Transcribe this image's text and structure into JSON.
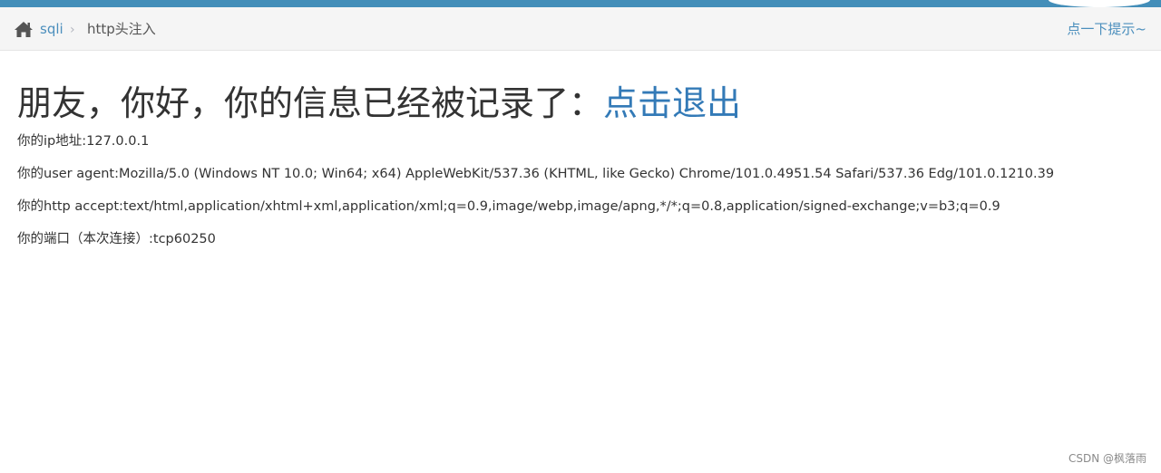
{
  "breadcrumbs": {
    "home_icon": "home-icon",
    "link_label": "sqli",
    "separator": "›",
    "current_label": "http头注入"
  },
  "hint_link": "点一下提示~",
  "headline": {
    "text": "朋友，你好，你的信息已经被记录了：",
    "logout_label": "点击退出"
  },
  "info": {
    "ip": "你的ip地址:127.0.0.1",
    "user_agent": "你的user agent:Mozilla/5.0 (Windows NT 10.0; Win64; x64) AppleWebKit/537.36 (KHTML, like Gecko) Chrome/101.0.4951.54 Safari/537.36 Edg/101.0.1210.39",
    "accept": "你的http accept:text/html,application/xhtml+xml,application/xml;q=0.9,image/webp,image/apng,*/*;q=0.8,application/signed-exchange;v=b3;q=0.9",
    "port": "你的端口（本次连接）:tcp60250"
  },
  "watermark": "CSDN @枫落雨",
  "colors": {
    "topbar": "#438eb9",
    "link": "#4c8fbd",
    "headline_link": "#337ab7",
    "breadcrumb_bg": "#f5f5f5"
  }
}
